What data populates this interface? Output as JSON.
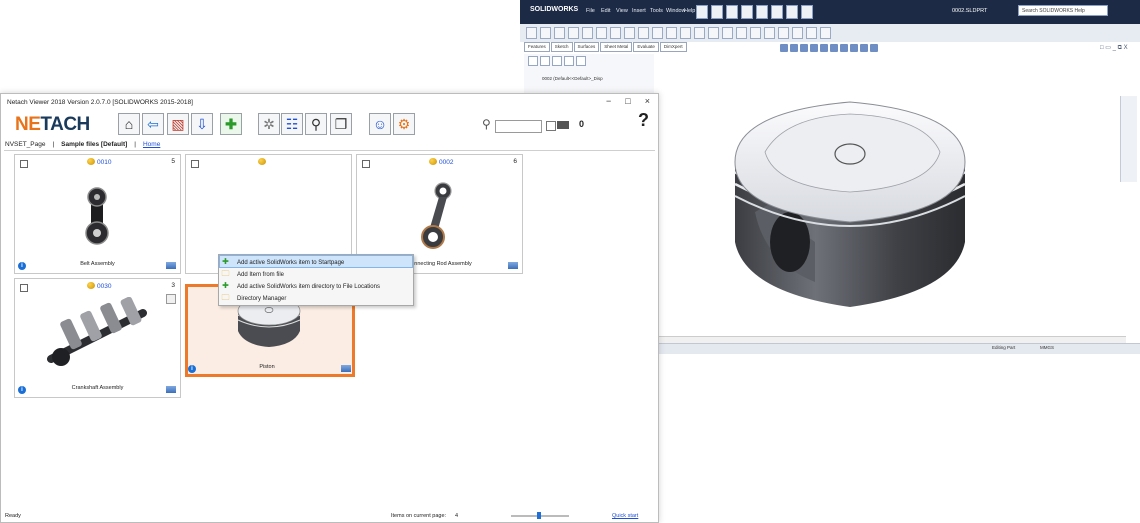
{
  "solidworks": {
    "logo": "SOLIDWORKS",
    "menus": [
      "File",
      "Edit",
      "View",
      "Insert",
      "Tools",
      "Window",
      "Help"
    ],
    "document": "0002.SLDPRT",
    "search_placeholder": "Search SOLIDWORKS Help",
    "tabs": [
      "Features",
      "Sketch",
      "Surfaces",
      "Sheet Metal",
      "Evaluate",
      "DimXpert"
    ],
    "tree_part": "0002 (Default<<Default>_Disp",
    "window_controls": "□ ▭ _ ⧉ X",
    "status_editing": "Editing Part",
    "status_units": "MMGS",
    "accent": "#1c2a45"
  },
  "netach": {
    "title": "Netach Viewer 2018   Version 2.0.7.0   [SOLIDWORKS 2015-2018]",
    "window_buttons": [
      "−",
      "□",
      "×"
    ],
    "logo_primary": "NE",
    "logo_accent": "TACH",
    "toolbar_icons": [
      "home-icon",
      "back-arrow-icon",
      "image-folder-icon",
      "down-arrow-icon",
      "add-plus-icon",
      "settings-gear-icon",
      "tree-view-icon",
      "search-magnifier-icon",
      "copy-pages-icon",
      "user-help-icon",
      "network-icon"
    ],
    "items_count": "0",
    "help": "?",
    "breadcrumb": {
      "page": "NVSET_Page",
      "sep1": "|",
      "group": "Sample files [Default]",
      "sep2": "|",
      "home": "Home"
    },
    "menu": [
      {
        "label": "Add active SolidWorks item to Startpage",
        "icon": "✚",
        "selected": true
      },
      {
        "label": "Add Item from file",
        "icon": "🗀",
        "selected": false
      },
      {
        "label": "Add active SolidWorks item directory to File Locations",
        "icon": "✚",
        "selected": false
      },
      {
        "label": "Directory Manager",
        "icon": "🗀",
        "selected": false
      }
    ],
    "cards": [
      {
        "code": "0010",
        "count": "5",
        "name": "Belt Assembly"
      },
      {
        "code": "",
        "count": "",
        "name": "Piston"
      },
      {
        "code": "0002",
        "count": "6",
        "name": "Connecting Rod Assembly"
      },
      {
        "code": "0030",
        "count": "3",
        "name": "Crankshaft Assembly"
      }
    ],
    "status_ready": "Ready",
    "status_items": "Items on current page:",
    "status_items_value": "4",
    "quick_start": "Quick start",
    "accent_orange": "#ec7a2a",
    "accent_blue": "#1a3a5c"
  }
}
